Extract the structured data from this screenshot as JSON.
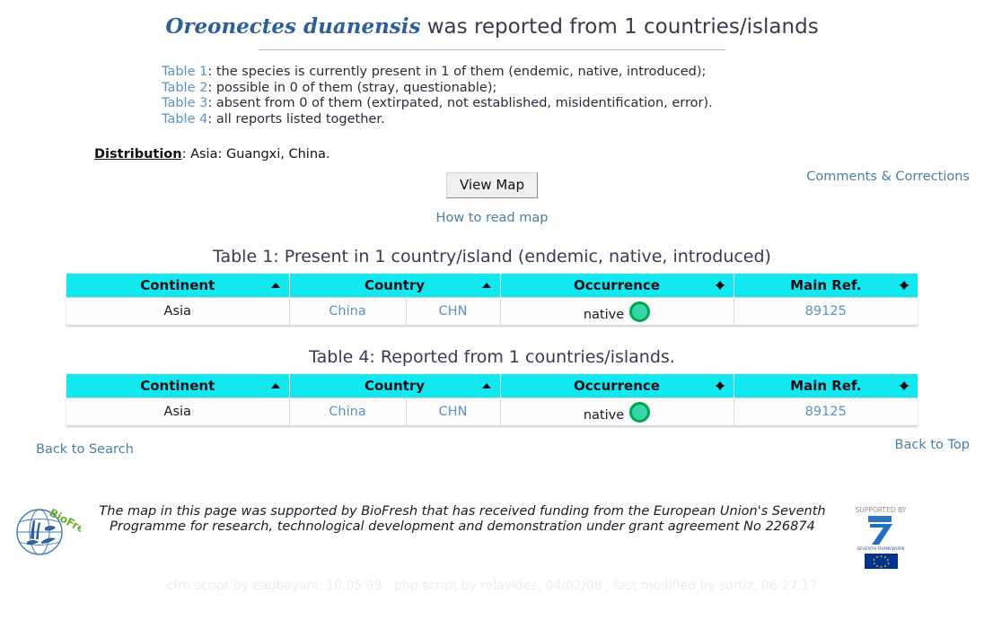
{
  "title": {
    "species": "Oreonectes duanensis",
    "rest": " was reported from 1 countries/islands"
  },
  "legend": [
    {
      "link": "Table 1",
      "text": ": the species is currently present in 1 of them (endemic, native, introduced);"
    },
    {
      "link": "Table 2",
      "text": ": possible in 0 of them (stray, questionable);"
    },
    {
      "link": "Table 3",
      "text": ": absent from 0 of them (extirpated, not established, misidentification, error)."
    },
    {
      "link": "Table 4",
      "text": ": all reports listed together."
    }
  ],
  "distribution": {
    "label": "Distribution",
    "value": ": Asia: Guangxi, China."
  },
  "comments_link": "Comments & Corrections",
  "map": {
    "button_label": "View Map",
    "how_to_read": "How to read map"
  },
  "table1": {
    "caption": "Table 1: Present in 1 country/island (endemic, native, introduced)",
    "headers": [
      "Continent",
      "Country",
      "Occurrence",
      "Main Ref."
    ],
    "rows": [
      {
        "continent": "Asia",
        "country": "China",
        "code": "CHN",
        "occurrence": "native",
        "main_ref": "89125"
      }
    ]
  },
  "table4": {
    "caption": "Table 4: Reported from 1 countries/islands.",
    "headers": [
      "Continent",
      "Country",
      "Occurrence",
      "Main Ref."
    ],
    "rows": [
      {
        "continent": "Asia",
        "country": "China",
        "code": "CHN",
        "occurrence": "native",
        "main_ref": "89125"
      }
    ]
  },
  "bottom": {
    "back_to_search": "Back to Search",
    "back_to_top": "Back to Top"
  },
  "footer": {
    "text": "The map in this page was supported by BioFresh that has received funding from the European Union's Seventh Programme for research, technological development and demonstration under grant agreement No 226874",
    "supported_by": "SUPPORTED BY",
    "fp7_number": "7",
    "fp7_caption": "SEVENTH FRAMEWORK PROGRAMME",
    "biofresh_label": "BioFresh",
    "credits": "cfm script by eagbayani, 10.05.99 ,  php script by rolavides, 04/02/08 ,  last modified by sortiz, 06.27.17"
  },
  "colors": {
    "header_cyan": "#12e8ef",
    "link_blue": "#5b93c4",
    "species_blue": "#2d5f9a",
    "occurrence_green": "#00a651"
  }
}
